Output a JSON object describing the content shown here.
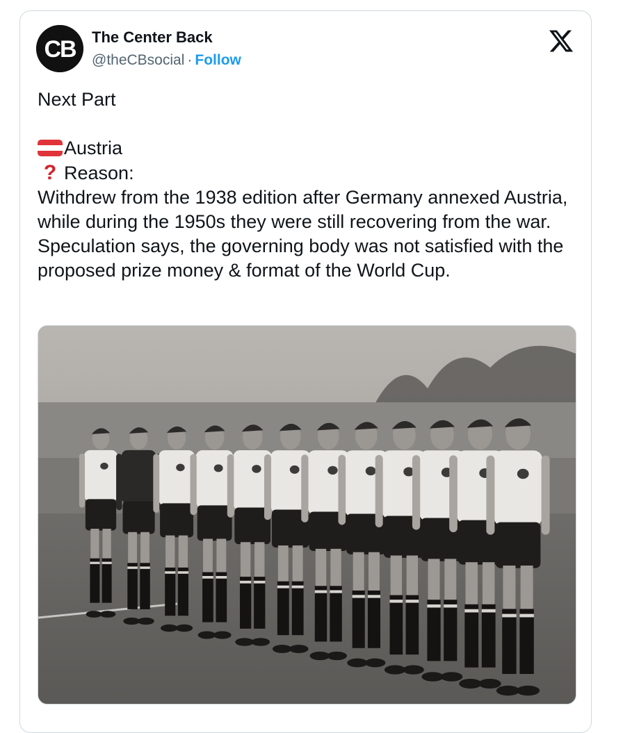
{
  "tweet": {
    "author_name": "The Center Back",
    "handle": "@theCBsocial",
    "separator": "·",
    "follow_label": "Follow",
    "avatar_initials": "CB",
    "platform_icon": "x-logo-icon",
    "text": {
      "line1": "Next Part",
      "country": "Austria",
      "reason_label": "Reason:",
      "reason_body": "Withdrew from the 1938 edition after Germany annexed Austria, while during the 1950s they were still recovering from the war. Speculation says, the governing body was not satisfied with the proposed prize money & format of the World Cup."
    },
    "emojis": {
      "flag": "austria-flag-icon",
      "question": "red-question-mark-icon"
    },
    "media": {
      "kind": "black-and-white team photo",
      "players_count": 12
    }
  },
  "colors": {
    "text": "#0f1419",
    "secondary": "#536471",
    "link": "#1d9bf0",
    "border": "#cfd9de",
    "flag_red": "#e0343b",
    "question_red": "#d2232a"
  }
}
